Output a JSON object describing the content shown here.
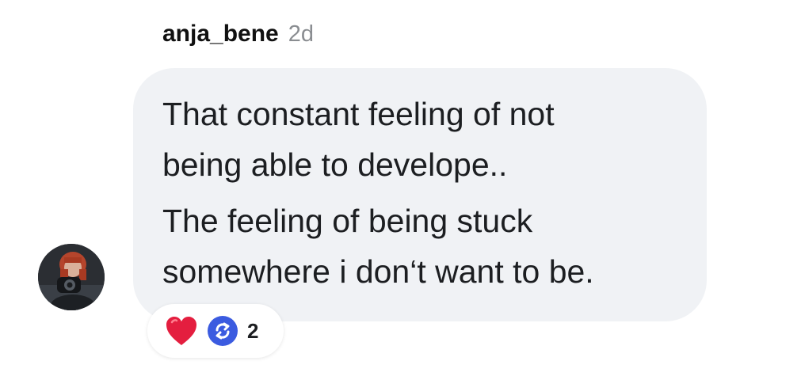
{
  "comment": {
    "username": "anja_bene",
    "timestamp": "2d",
    "lines": [
      "That constant feeling of not",
      "being able to develope..",
      "The feeling of being stuck",
      "somewhere i don‘t want to be."
    ],
    "paragraphs": [
      "That constant feeling of not being able to develope..",
      "The feeling of being stuck somewhere i don‘t want to be."
    ],
    "avatar_icon": "user-avatar-photo",
    "reactions": {
      "icons": [
        "heart-icon",
        "repost-icon"
      ],
      "count": "2"
    }
  },
  "colors": {
    "bubble": "#f0f2f5",
    "heart": "#e41e3f",
    "repost_badge": "#3b5be0",
    "timestamp": "#8a8d91"
  }
}
